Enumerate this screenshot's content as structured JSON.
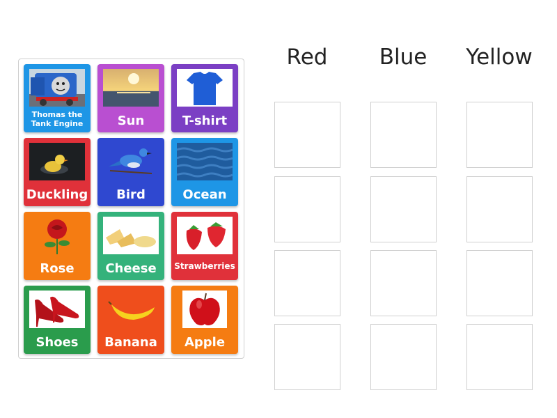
{
  "columns": [
    {
      "label": "Red"
    },
    {
      "label": "Blue"
    },
    {
      "label": "Yellow"
    }
  ],
  "cards": [
    {
      "label": "Thomas the Tank Engine",
      "color": "#1e96e6",
      "image": "train-picture"
    },
    {
      "label": "Sun",
      "color": "#b94fd1",
      "image": "sunset-picture"
    },
    {
      "label": "T-shirt",
      "color": "#7b3fc4",
      "image": "tshirt-picture"
    },
    {
      "label": "Duckling",
      "color": "#e0313a",
      "image": "duckling-picture"
    },
    {
      "label": "Bird",
      "color": "#2f48d0",
      "image": "bluebird-picture"
    },
    {
      "label": "Ocean",
      "color": "#1e96e6",
      "image": "ocean-picture"
    },
    {
      "label": "Rose",
      "color": "#f57c12",
      "image": "rose-picture"
    },
    {
      "label": "Cheese",
      "color": "#34b27b",
      "image": "cheese-picture"
    },
    {
      "label": "Strawberries",
      "color": "#e0313a",
      "image": "strawberries-picture"
    },
    {
      "label": "Shoes",
      "color": "#2a9c4c",
      "image": "shoes-picture"
    },
    {
      "label": "Banana",
      "color": "#ef4e1c",
      "image": "banana-picture"
    },
    {
      "label": "Apple",
      "color": "#f57c12",
      "image": "apple-picture"
    }
  ]
}
